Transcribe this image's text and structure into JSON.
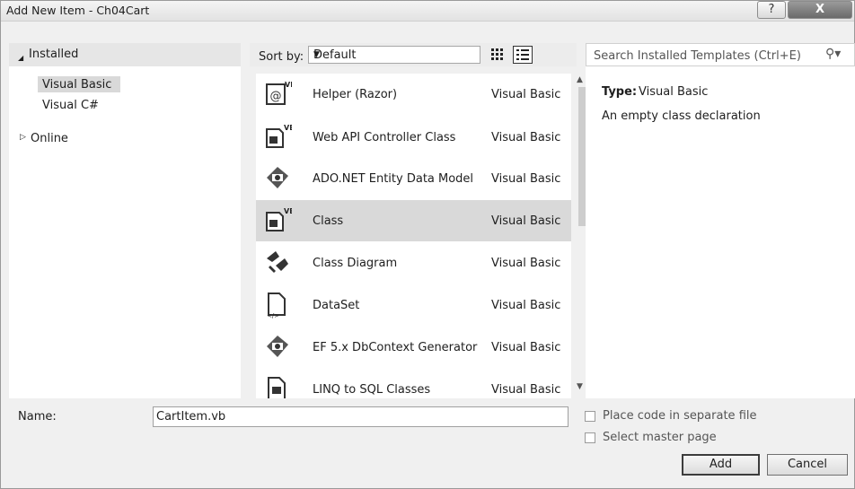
{
  "window": {
    "title": "Add New Item - Ch04Cart",
    "help_label": "?",
    "close_label": "X"
  },
  "tree": {
    "installed": "Installed",
    "items": [
      "Visual Basic",
      "Visual C#"
    ],
    "online": "Online"
  },
  "sort": {
    "label": "Sort by:",
    "value": "Default"
  },
  "search": {
    "placeholder": "Search Installed Templates (Ctrl+E)"
  },
  "templates": [
    {
      "name": "Helper (Razor)",
      "lang": "Visual Basic",
      "icon": "razor-helper-icon",
      "selected": false
    },
    {
      "name": "Web API Controller Class",
      "lang": "Visual Basic",
      "icon": "vb-class-icon",
      "selected": false
    },
    {
      "name": "ADO.NET Entity Data Model",
      "lang": "Visual Basic",
      "icon": "entity-model-icon",
      "selected": false
    },
    {
      "name": "Class",
      "lang": "Visual Basic",
      "icon": "vb-class-icon",
      "selected": true
    },
    {
      "name": "Class Diagram",
      "lang": "Visual Basic",
      "icon": "class-diagram-icon",
      "selected": false
    },
    {
      "name": "DataSet",
      "lang": "Visual Basic",
      "icon": "dataset-icon",
      "selected": false
    },
    {
      "name": "EF 5.x DbContext Generator",
      "lang": "Visual Basic",
      "icon": "entity-model-icon",
      "selected": false
    },
    {
      "name": "LINQ to SQL Classes",
      "lang": "Visual Basic",
      "icon": "linq-icon",
      "selected": false
    }
  ],
  "details": {
    "type_label": "Type:",
    "type_value": "Visual Basic",
    "description": "An empty class declaration"
  },
  "footer": {
    "name_label": "Name:",
    "name_value": "CartItem.vb",
    "separate_file_label": "Place code in separate file",
    "master_page_label": "Select master page",
    "add_label": "Add",
    "cancel_label": "Cancel"
  }
}
